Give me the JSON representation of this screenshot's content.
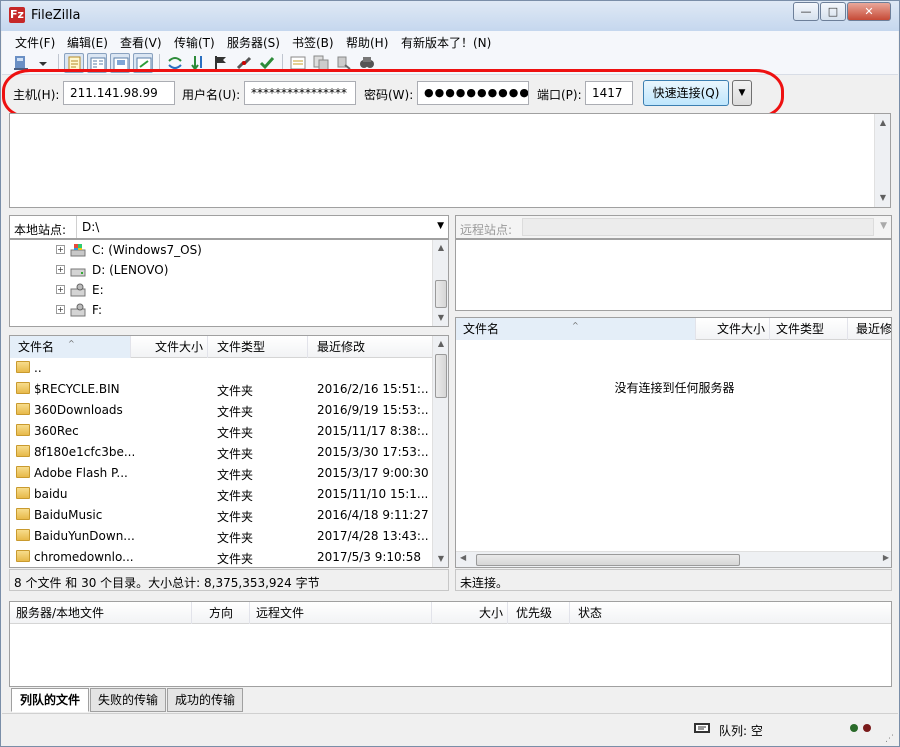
{
  "window": {
    "title": "FileZilla",
    "app_icon": "Fz"
  },
  "menu": [
    {
      "label": "文件(F)"
    },
    {
      "label": "编辑(E)"
    },
    {
      "label": "查看(V)"
    },
    {
      "label": "传输(T)"
    },
    {
      "label": "服务器(S)"
    },
    {
      "label": "书签(B)"
    },
    {
      "label": "帮助(H)"
    },
    {
      "label": "有新版本了！(N)"
    }
  ],
  "quickconnect": {
    "host_label": "主机(H):",
    "host_value": "211.141.98.99",
    "user_label": "用户名(U):",
    "user_value": "****************",
    "pass_label": "密码(W):",
    "pass_value": "●●●●●●●●●●●",
    "port_label": "端口(P):",
    "port_value": "1417",
    "connect_label": "快速连接(Q)",
    "dropdown_glyph": "▼"
  },
  "local": {
    "site_label": "本地站点:",
    "site_path": "D:\\",
    "tree": [
      {
        "label": "C: (Windows7_OS)"
      },
      {
        "label": "D: (LENOVO)"
      },
      {
        "label": "E:"
      },
      {
        "label": "F:"
      }
    ],
    "columns": {
      "name": "文件名",
      "size": "文件大小",
      "type": "文件类型",
      "modified": "最近修改"
    },
    "rows": [
      {
        "name": "..",
        "type": "",
        "modified": ""
      },
      {
        "name": "$RECYCLE.BIN",
        "type": "文件夹",
        "modified": "2016/2/16 15:51:..."
      },
      {
        "name": "360Downloads",
        "type": "文件夹",
        "modified": "2016/9/19 15:53:..."
      },
      {
        "name": "360Rec",
        "type": "文件夹",
        "modified": "2015/11/17 8:38:..."
      },
      {
        "name": "8f180e1cfc3be...",
        "type": "文件夹",
        "modified": "2015/3/30 17:53:..."
      },
      {
        "name": "Adobe Flash P...",
        "type": "文件夹",
        "modified": "2015/3/17 9:00:30"
      },
      {
        "name": "baidu",
        "type": "文件夹",
        "modified": "2015/11/10 15:1..."
      },
      {
        "name": "BaiduMusic",
        "type": "文件夹",
        "modified": "2016/4/18 9:11:27"
      },
      {
        "name": "BaiduYunDown...",
        "type": "文件夹",
        "modified": "2017/4/28 13:43:..."
      },
      {
        "name": "chromedownlo...",
        "type": "文件夹",
        "modified": "2017/5/3 9:10:58"
      }
    ],
    "status": "8 个文件 和 30 个目录。大小总计: 8,375,353,924 字节"
  },
  "remote": {
    "site_label": "远程站点:",
    "site_path": "",
    "columns": {
      "name": "文件名",
      "size": "文件大小",
      "type": "文件类型",
      "modified": "最近修"
    },
    "empty_message": "没有连接到任何服务器",
    "status": "未连接。"
  },
  "queue": {
    "columns": {
      "server": "服务器/本地文件",
      "direction": "方向",
      "remote": "远程文件",
      "size": "大小",
      "priority": "优先级",
      "status": "状态"
    },
    "tabs": [
      {
        "label": "列队的文件"
      },
      {
        "label": "失败的传输"
      },
      {
        "label": "成功的传输"
      }
    ]
  },
  "statusbar": {
    "queue_label": "队列: 空"
  },
  "colors": {
    "annotation_ring": "#e11111",
    "accent": "#3c7fb1"
  }
}
